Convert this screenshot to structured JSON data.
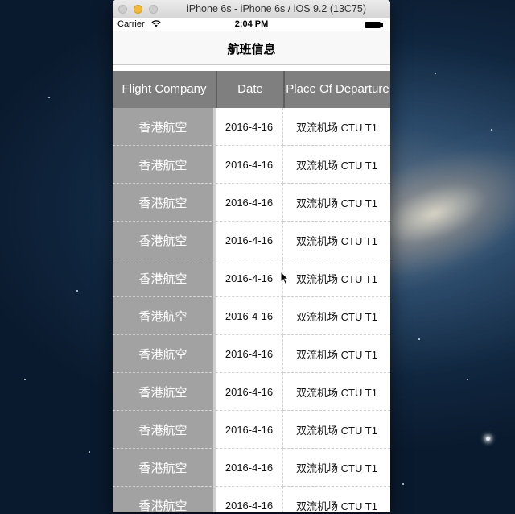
{
  "window": {
    "title": "iPhone 6s - iPhone 6s / iOS 9.2 (13C75)"
  },
  "statusbar": {
    "carrier": "Carrier",
    "time": "2:04 PM"
  },
  "navbar": {
    "title": "航班信息"
  },
  "table": {
    "headers": {
      "company": "Flight Company",
      "date": "Date",
      "place": "Place Of Departure"
    },
    "rows": [
      {
        "company": "香港航空",
        "date": "2016-4-16",
        "place": "双流机场 CTU T1"
      },
      {
        "company": "香港航空",
        "date": "2016-4-16",
        "place": "双流机场 CTU T1"
      },
      {
        "company": "香港航空",
        "date": "2016-4-16",
        "place": "双流机场 CTU T1"
      },
      {
        "company": "香港航空",
        "date": "2016-4-16",
        "place": "双流机场 CTU T1"
      },
      {
        "company": "香港航空",
        "date": "2016-4-16",
        "place": "双流机场 CTU T1"
      },
      {
        "company": "香港航空",
        "date": "2016-4-16",
        "place": "双流机场 CTU T1"
      },
      {
        "company": "香港航空",
        "date": "2016-4-16",
        "place": "双流机场 CTU T1"
      },
      {
        "company": "香港航空",
        "date": "2016-4-16",
        "place": "双流机场 CTU T1"
      },
      {
        "company": "香港航空",
        "date": "2016-4-16",
        "place": "双流机场 CTU T1"
      },
      {
        "company": "香港航空",
        "date": "2016-4-16",
        "place": "双流机场 CTU T1"
      },
      {
        "company": "香港航空",
        "date": "2016-4-16",
        "place": "双流机场 CTU T1"
      }
    ]
  },
  "colors": {
    "header_bg": "#7f7f7f",
    "company_cell_bg": "#a2a2a2",
    "minimize_button": "#f3b93a"
  },
  "icons": [
    "close-button",
    "minimize-button",
    "zoom-button",
    "wifi-icon",
    "battery-icon",
    "cursor-icon"
  ]
}
